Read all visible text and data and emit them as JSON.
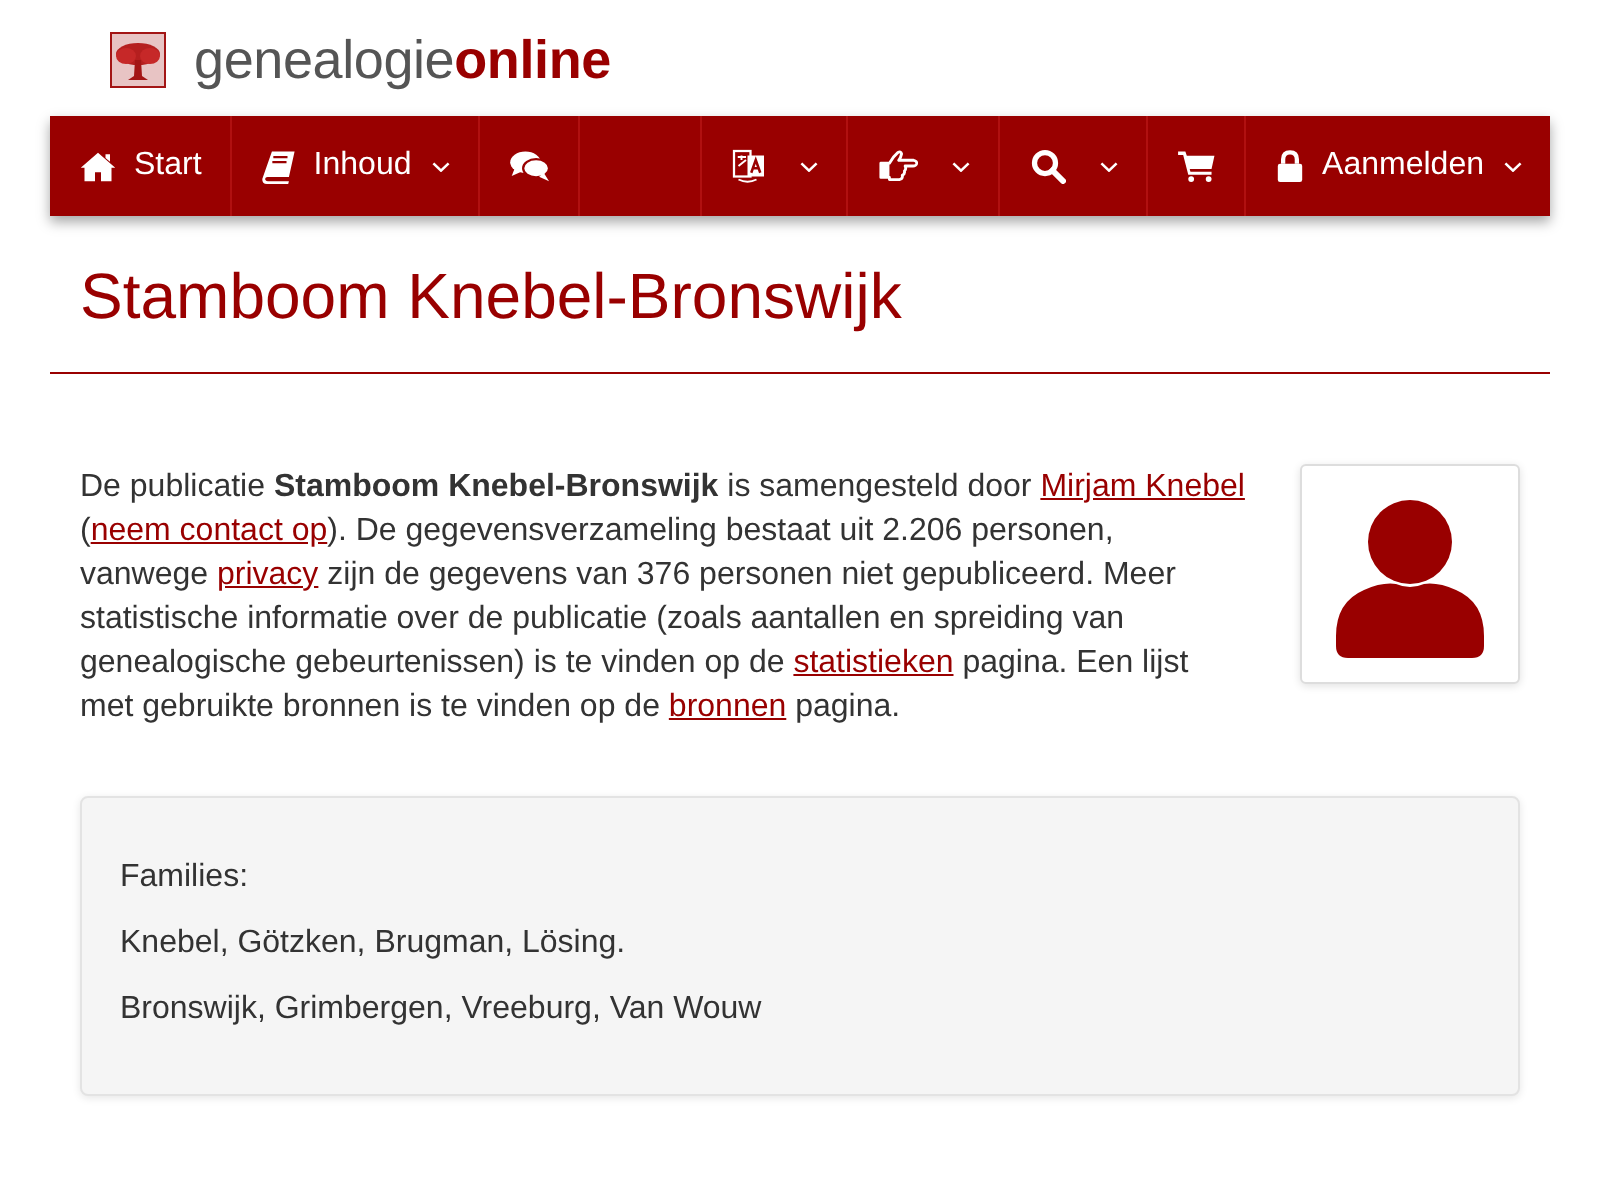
{
  "logo": {
    "text": "genealogie**online**"
  },
  "nav": {
    "left": [
      {
        "kind": "home",
        "label": "Start",
        "caret": false
      },
      {
        "kind": "book",
        "label": "Inhoud",
        "caret": true
      },
      {
        "kind": "comments",
        "caret": false
      }
    ],
    "right": [
      {
        "kind": "translate",
        "caret": true
      },
      {
        "kind": "hand",
        "caret": true
      },
      {
        "kind": "search",
        "caret": true
      },
      {
        "kind": "cart",
        "caret": false
      },
      {
        "kind": "lock",
        "label": "Aanmelden",
        "caret": true
      }
    ]
  },
  "title": "Stamboom Knebel-Bronswijk",
  "description": [
    {
      "kind": "text",
      "text": "De publicatie **Stamboom Knebel-Bronswijk** is samengesteld door "
    },
    {
      "kind": "link",
      "text": "Mirjam Knebel"
    },
    {
      "kind": "text",
      "text": " ("
    },
    {
      "kind": "link",
      "text": "neem contact op"
    },
    {
      "kind": "text",
      "text": "). De gegevensverzameling bestaat uit 2.206 personen, vanwege "
    },
    {
      "kind": "link",
      "text": "privacy"
    },
    {
      "kind": "text",
      "text": " zijn de gegevens van 376 personen niet gepubliceerd. Meer statistische informatie over de publicatie (zoals aantallen en spreiding van genealogische gebeurtenissen) is te vinden op de "
    },
    {
      "kind": "link",
      "text": "statistieken"
    },
    {
      "kind": "text",
      "text": " pagina. Een lijst met gebruikte bronnen is te vinden op de "
    },
    {
      "kind": "link",
      "text": "bronnen"
    },
    {
      "kind": "text",
      "text": " pagina."
    }
  ],
  "families": {
    "heading": "Families:",
    "lines": [
      "Knebel, Götzken, Brugman, Lösing.",
      "Bronswijk, Grimbergen, Vreeburg, Van Wouw"
    ]
  }
}
